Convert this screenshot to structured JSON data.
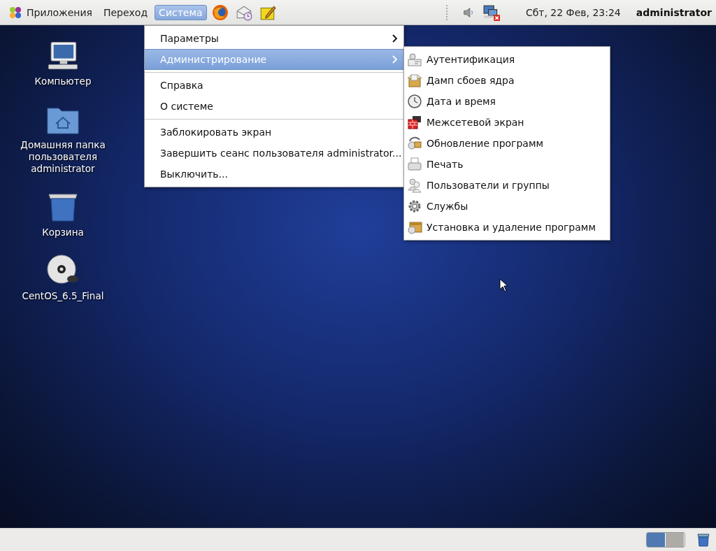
{
  "top_panel": {
    "menus": [
      {
        "label": "Приложения",
        "selected": false
      },
      {
        "label": "Переход",
        "selected": false
      },
      {
        "label": "Система",
        "selected": true
      }
    ],
    "launchers": [
      {
        "kind": "browser"
      },
      {
        "kind": "mail"
      },
      {
        "kind": "notes"
      }
    ],
    "tray": [
      {
        "kind": "volume"
      },
      {
        "kind": "network"
      }
    ],
    "clock": "Сбт, 22 Фев, 23:24",
    "user": "administrator"
  },
  "desktop_icons": [
    {
      "kind": "computer",
      "label": "Компьютер"
    },
    {
      "kind": "home",
      "label": "Домашняя папка пользователя administrator"
    },
    {
      "kind": "trash",
      "label": "Корзина"
    },
    {
      "kind": "disc",
      "label": "CentOS_6.5_Final"
    }
  ],
  "system_menu": [
    {
      "kind": "submenu",
      "label": "Параметры",
      "selected": false
    },
    {
      "kind": "submenu",
      "label": "Администрирование",
      "selected": true
    },
    {
      "kind": "separator"
    },
    {
      "kind": "item",
      "label": "Справка",
      "selected": false
    },
    {
      "kind": "item",
      "label": "О системе",
      "selected": false
    },
    {
      "kind": "separator"
    },
    {
      "kind": "item",
      "label": "Заблокировать экран",
      "selected": false
    },
    {
      "kind": "item",
      "label": "Завершить сеанс пользователя administrator...",
      "selected": false
    },
    {
      "kind": "item",
      "label": "Выключить...",
      "selected": false
    }
  ],
  "admin_submenu": [
    {
      "kind": "auth",
      "label": "Аутентификация"
    },
    {
      "kind": "box",
      "label": "Дамп сбоев ядра"
    },
    {
      "kind": "clock",
      "label": "Дата и время"
    },
    {
      "kind": "firewall",
      "label": "Межсетевой экран"
    },
    {
      "kind": "update",
      "label": "Обновление программ"
    },
    {
      "kind": "printer",
      "label": "Печать"
    },
    {
      "kind": "users",
      "label": "Пользователи и группы"
    },
    {
      "kind": "gear",
      "label": "Службы"
    },
    {
      "kind": "package",
      "label": "Установка и удаление программ"
    }
  ],
  "bottom_panel": {
    "workspaces": [
      {
        "selected": true
      },
      {
        "selected": false
      }
    ]
  }
}
